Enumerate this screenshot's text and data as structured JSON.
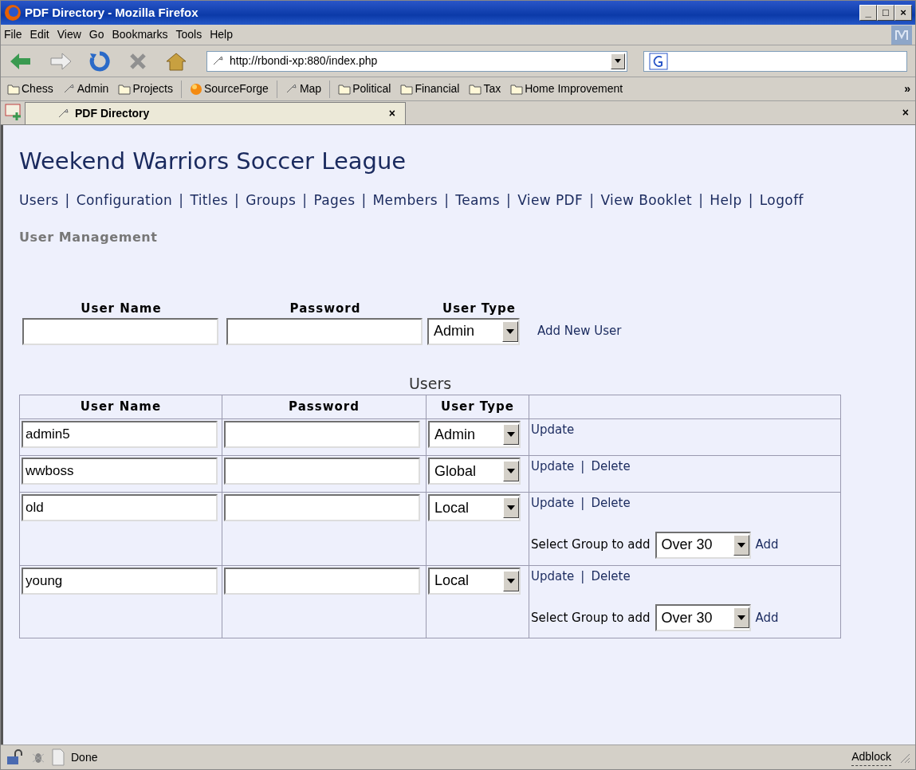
{
  "window": {
    "title": "PDF Directory - Mozilla Firefox",
    "controls": [
      "_",
      "□",
      "×"
    ]
  },
  "menu": [
    "File",
    "Edit",
    "View",
    "Go",
    "Bookmarks",
    "Tools",
    "Help"
  ],
  "toolbar": {
    "url": "http://rbondi-xp:880/index.php"
  },
  "bookmarks": [
    {
      "label": "Chess",
      "kind": "folder"
    },
    {
      "label": "Admin",
      "kind": "link"
    },
    {
      "label": "Projects",
      "kind": "folder"
    },
    {
      "label": "SourceForge",
      "kind": "sphere"
    },
    {
      "label": "Map",
      "kind": "link"
    },
    {
      "label": "Political",
      "kind": "folder"
    },
    {
      "label": "Financial",
      "kind": "folder"
    },
    {
      "label": "Tax",
      "kind": "folder"
    },
    {
      "label": "Home Improvement",
      "kind": "folder"
    }
  ],
  "bookmarks_more": "»",
  "tabs": [
    {
      "label": "PDF Directory",
      "selected": true,
      "close": "×"
    }
  ],
  "tabbar_close": "×",
  "page": {
    "heading": "Weekend Warriors Soccer League",
    "separator": "|",
    "nav": [
      "Users",
      "Configuration",
      "Titles",
      "Groups",
      "Pages",
      "Members",
      "Teams",
      "View PDF",
      "View Booklet",
      "Help",
      "Logoff"
    ],
    "section_title": "User Management",
    "new_user": {
      "columns": [
        "User Name",
        "Password",
        "User Type"
      ],
      "user_type": "Admin",
      "add_link": "Add New User"
    },
    "users_table": {
      "caption": "Users",
      "columns": [
        "User Name",
        "Password",
        "User Type"
      ],
      "rows": [
        {
          "user_name": "admin5",
          "user_type": "Admin",
          "actions": [
            "Update"
          ]
        },
        {
          "user_name": "wwboss",
          "user_type": "Global",
          "actions": [
            "Update",
            "Delete"
          ]
        },
        {
          "user_name": "old",
          "user_type": "Local",
          "actions": [
            "Update",
            "Delete"
          ],
          "group_select": {
            "label": "Select Group to add",
            "value": "Over 30",
            "add": "Add"
          }
        },
        {
          "user_name": "young",
          "user_type": "Local",
          "actions": [
            "Update",
            "Delete"
          ],
          "group_select": {
            "label": "Select Group to add",
            "value": "Over 30",
            "add": "Add"
          }
        }
      ]
    }
  },
  "status_bar": {
    "text": "Done",
    "adblock": "Adblock"
  }
}
